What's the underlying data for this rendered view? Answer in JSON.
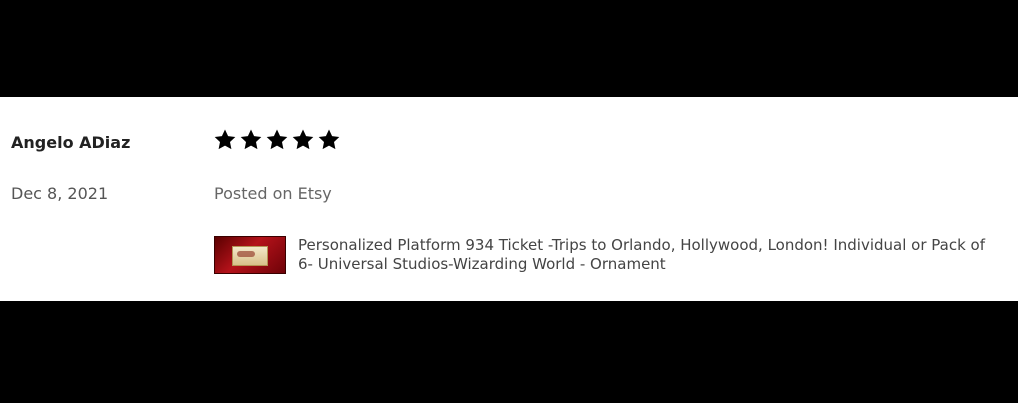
{
  "review": {
    "reviewer_name": "Angelo ADiaz",
    "date": "Dec 8, 2021",
    "rating": 5,
    "rating_max": 5,
    "star_icon": "star-icon",
    "star_color": "#000000",
    "posted_on": "Posted on Etsy",
    "listing": {
      "thumbnail_icon": "ticket-ornament-thumbnail",
      "title": "Personalized Platform 934 Ticket -Trips to Orlando, Hollywood, London! Individual or Pack of 6- Universal Studios-Wizarding World - Ornament"
    }
  }
}
